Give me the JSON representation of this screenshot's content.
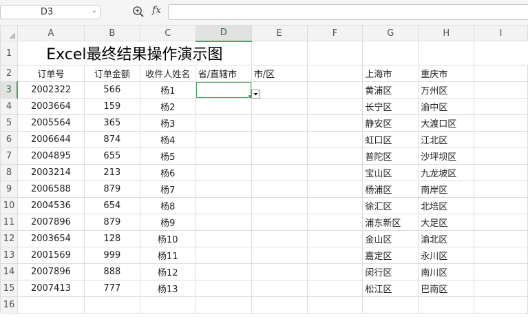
{
  "formula_bar": {
    "name_box": "D3",
    "name_box_arrow": "⌄",
    "fx_label": "fx",
    "formula": ""
  },
  "columns": [
    "A",
    "B",
    "C",
    "D",
    "E",
    "F",
    "G",
    "H",
    "I"
  ],
  "selected_cell": "D3",
  "rows": [
    {
      "num": "1",
      "cells": [
        "Excel最终结果操作演示图",
        "",
        "",
        "",
        "",
        "",
        "",
        "",
        ""
      ]
    },
    {
      "num": "2",
      "cells": [
        "订单号",
        "订单金额",
        "收件人姓名",
        "省/直辖市",
        "市/区",
        "",
        "上海市",
        "重庆市",
        ""
      ]
    },
    {
      "num": "3",
      "cells": [
        "2002322",
        "566",
        "杨1",
        "",
        "",
        "",
        "黄浦区",
        "万州区",
        ""
      ]
    },
    {
      "num": "4",
      "cells": [
        "2003664",
        "159",
        "杨2",
        "",
        "",
        "",
        "长宁区",
        "渝中区",
        ""
      ]
    },
    {
      "num": "5",
      "cells": [
        "2005564",
        "365",
        "杨3",
        "",
        "",
        "",
        "静安区",
        "大渡口区",
        ""
      ]
    },
    {
      "num": "6",
      "cells": [
        "2006644",
        "874",
        "杨4",
        "",
        "",
        "",
        "虹口区",
        "江北区",
        ""
      ]
    },
    {
      "num": "7",
      "cells": [
        "2004895",
        "655",
        "杨5",
        "",
        "",
        "",
        "普陀区",
        "沙坪坝区",
        ""
      ]
    },
    {
      "num": "8",
      "cells": [
        "2003214",
        "213",
        "杨6",
        "",
        "",
        "",
        "宝山区",
        "九龙坡区",
        ""
      ]
    },
    {
      "num": "9",
      "cells": [
        "2006588",
        "879",
        "杨7",
        "",
        "",
        "",
        "杨浦区",
        "南岸区",
        ""
      ]
    },
    {
      "num": "10",
      "cells": [
        "2004536",
        "654",
        "杨8",
        "",
        "",
        "",
        "徐汇区",
        "北培区",
        ""
      ]
    },
    {
      "num": "11",
      "cells": [
        "2007896",
        "879",
        "杨9",
        "",
        "",
        "",
        "浦东新区",
        "大足区",
        ""
      ]
    },
    {
      "num": "12",
      "cells": [
        "2003654",
        "128",
        "杨10",
        "",
        "",
        "",
        "金山区",
        "渝北区",
        ""
      ]
    },
    {
      "num": "13",
      "cells": [
        "2001569",
        "999",
        "杨11",
        "",
        "",
        "",
        "嘉定区",
        "永川区",
        ""
      ]
    },
    {
      "num": "14",
      "cells": [
        "2007896",
        "888",
        "杨12",
        "",
        "",
        "",
        "闵行区",
        "南川区",
        ""
      ]
    },
    {
      "num": "15",
      "cells": [
        "2007413",
        "777",
        "杨13",
        "",
        "",
        "",
        "松江区",
        "巴南区",
        ""
      ]
    },
    {
      "num": "16",
      "cells": [
        "",
        "",
        "",
        "",
        "",
        "",
        "",
        "",
        ""
      ]
    }
  ],
  "colors": {
    "selection": "#4aa564",
    "header_bg": "#f3f3f3",
    "gridline": "#dcdcdc"
  }
}
